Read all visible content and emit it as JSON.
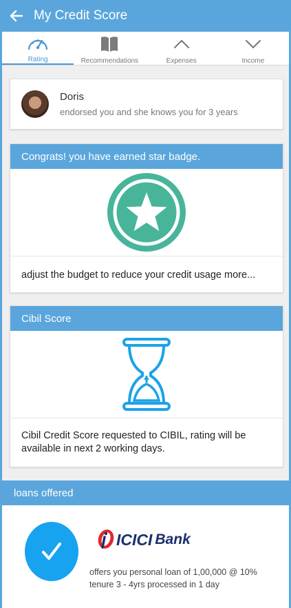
{
  "appbar": {
    "title": "My Credit Score",
    "back_icon": "arrow-left-icon"
  },
  "tabs": [
    {
      "label": "Rating",
      "icon": "speedometer-icon",
      "active": true
    },
    {
      "label": "Recommendations",
      "icon": "book-icon",
      "active": false
    },
    {
      "label": "Expenses",
      "icon": "chevron-up-icon",
      "active": false
    },
    {
      "label": "Income",
      "icon": "chevron-down-icon",
      "active": false
    }
  ],
  "endorsement": {
    "name": "Doris",
    "text": "endorsed you and she knows you for 3 years"
  },
  "badge_card": {
    "header": "Congrats! you have earned star badge.",
    "icon": "star-badge-icon",
    "message": "adjust the budget to reduce your credit usage more..."
  },
  "cibil_card": {
    "header": "Cibil Score",
    "icon": "hourglass-icon",
    "message": "Cibil Credit Score requested to CIBIL, rating will be available in next 2 working days."
  },
  "loans": {
    "header": "loans offered",
    "icon": "check-icon",
    "bank_mark": "i",
    "bank_name": "ICICI",
    "bank_suffix": "Bank",
    "offer_line1": "offers you personal loan of 1,00,000 @ 10%",
    "offer_line2": "tenure 3 - 4yrs processed in 1 day"
  },
  "colors": {
    "primary": "#5aa6dc",
    "badge_green": "#48b59b",
    "hourglass_blue": "#1aa3e8",
    "check_blue": "#17a3ef",
    "icici_red": "#e0282e",
    "icici_navy": "#1b2f6e"
  }
}
